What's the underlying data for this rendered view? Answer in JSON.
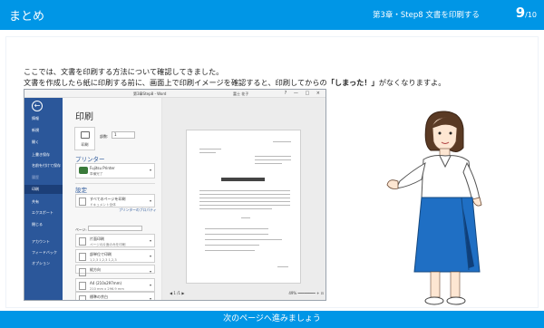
{
  "header": {
    "title": "まとめ",
    "chapter": "第3章・Step8 文書を印刷する",
    "page_current": "9",
    "page_total": "/10"
  },
  "intro": {
    "line1": "ここでは、文書を印刷する方法について確認してきました。",
    "line2_pre": "文書を作成したら紙に印刷する前に、画面上で印刷イメージを確認すると、印刷してからの",
    "line2_em": "「しまった！」",
    "line2_post": "がなくなりますよ。"
  },
  "screenshot": {
    "titlebar": {
      "document": "第3章Step8 - Word",
      "user": "富士 花子",
      "controls": "? — □ ×"
    },
    "backstage": {
      "back_symbol": "←",
      "items": [
        {
          "label": "情報",
          "state": "normal"
        },
        {
          "label": "新規",
          "state": "normal"
        },
        {
          "label": "開く",
          "state": "normal"
        },
        {
          "label": "上書き保存",
          "state": "normal"
        },
        {
          "label": "名前を付けて保存",
          "state": "normal"
        },
        {
          "label": "履歴",
          "state": "dim"
        },
        {
          "label": "印刷",
          "state": "selected"
        },
        {
          "label": "共有",
          "state": "normal"
        },
        {
          "label": "エクスポート",
          "state": "normal"
        },
        {
          "label": "閉じる",
          "state": "normal"
        },
        {
          "label": "アカウント",
          "state": "normal"
        },
        {
          "label": "フィードバック",
          "state": "normal"
        },
        {
          "label": "オプション",
          "state": "normal"
        }
      ]
    },
    "print_panel": {
      "heading": "印刷",
      "print_button_label": "印刷",
      "copies_label": "部数:",
      "copies_value": "1",
      "printer_section": "プリンター",
      "printer_name": "Fujitsu Printer",
      "printer_status": "準備完了",
      "printer_properties": "プリンターのプロパティ",
      "settings_section": "設定",
      "pages_label": "ページ:",
      "settings": [
        {
          "line1": "すべてのページを印刷",
          "line2": "ドキュメント全体"
        },
        {
          "line1": "片面印刷",
          "line2": "ページの片面のみを印刷"
        },
        {
          "line1": "部単位で印刷",
          "line2": "1,2,3 1,2,3 1,2,3"
        },
        {
          "line1": "縦方向",
          "line2": ""
        },
        {
          "line1": "A4 (210x297mm)",
          "line2": "210 mm x 296.9 mm"
        },
        {
          "line1": "標準の余白",
          "line2": "上: 35 mm 下: 30"
        },
        {
          "line1": "1 ページ/枚",
          "line2": ""
        }
      ]
    },
    "preview": {
      "page_indicator": "◀  1  /1  ▶",
      "zoom": "49%  ━━━━━━━━  +  ⊡"
    }
  },
  "footer": {
    "next_label": "次のページへ進みましょう"
  },
  "colors": {
    "brand_blue": "#0096e6",
    "word_blue": "#2b579a"
  }
}
